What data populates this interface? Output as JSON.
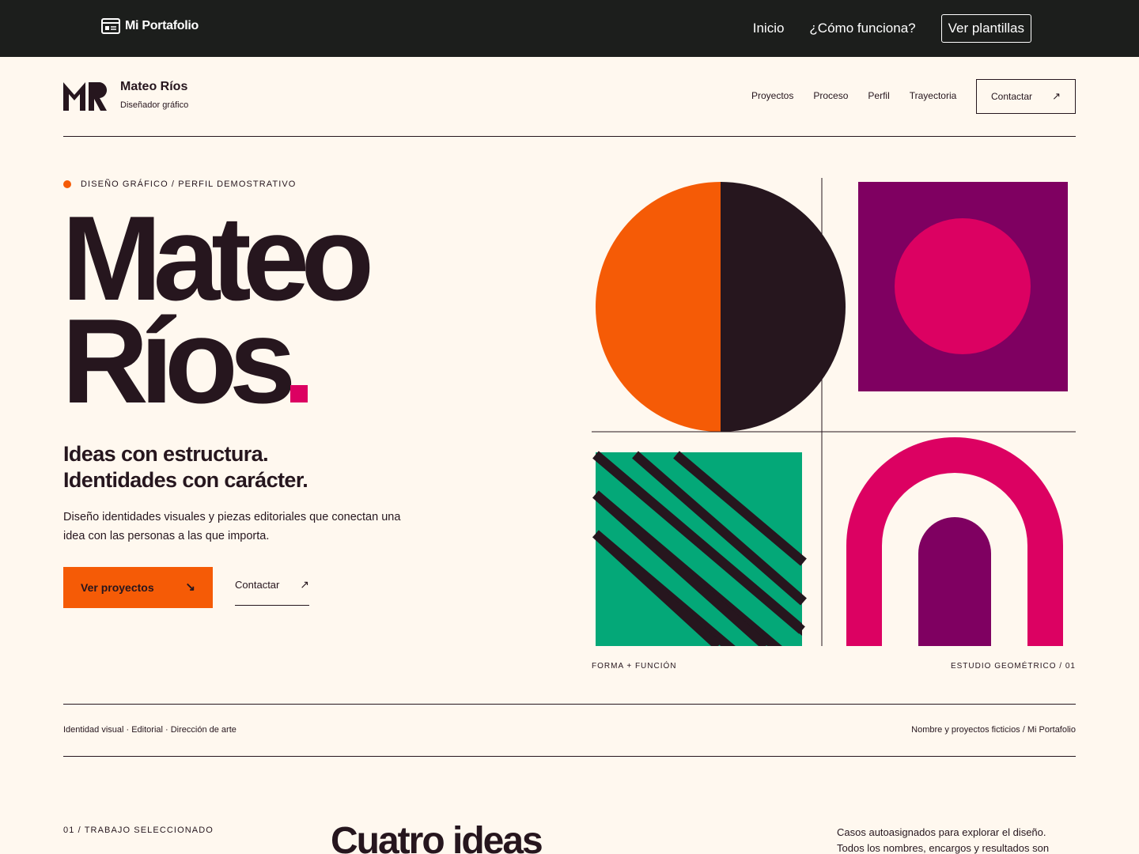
{
  "topbar": {
    "brand": "Mi Portafolio",
    "nav": [
      "Inicio",
      "¿Cómo funciona?"
    ],
    "cta": "Ver plantillas"
  },
  "header": {
    "name": "Mateo Ríos",
    "role": "Diseñador gráfico",
    "nav": [
      "Proyectos",
      "Proceso",
      "Perfil",
      "Trayectoria"
    ],
    "contact": "Contactar"
  },
  "hero": {
    "eyebrow": "DISEÑO GRÁFICO / PERFIL DEMOSTRATIVO",
    "title_line1": "Mateo",
    "title_line2": "Ríos",
    "tagline_line1": "Ideas con estructura.",
    "tagline_line2": "Identidades con carácter.",
    "description": "Diseño identidades visuales y piezas editoriales que conectan una idea con las personas a las que importa.",
    "primary_cta": "Ver proyectos",
    "secondary_cta": "Contactar"
  },
  "art": {
    "caption_left": "FORMA + FUNCIÓN",
    "caption_right": "ESTUDIO GEOMÉTRICO / 01"
  },
  "strip": {
    "left": "Identidad visual · Editorial · Dirección de arte",
    "right": "Nombre y proyectos ficticios / Mi Portafolio"
  },
  "section": {
    "label": "01 / TRABAJO SELECCIONADO",
    "title": "Cuatro ideas",
    "text": "Casos autoasignados para explorar el diseño. Todos los nombres, encargos y resultados son"
  },
  "colors": {
    "background": "#fff8ef",
    "ink": "#26161e",
    "orange": "#f55b06",
    "magenta": "#dc0162",
    "purple": "#7f0061",
    "green": "#04a878",
    "topbar": "#1c1e1c"
  },
  "icons": {
    "brand": "browser-window-icon",
    "contact_arrow": "arrow-up-right-icon",
    "cta_arrow": "arrow-down-right-icon"
  }
}
